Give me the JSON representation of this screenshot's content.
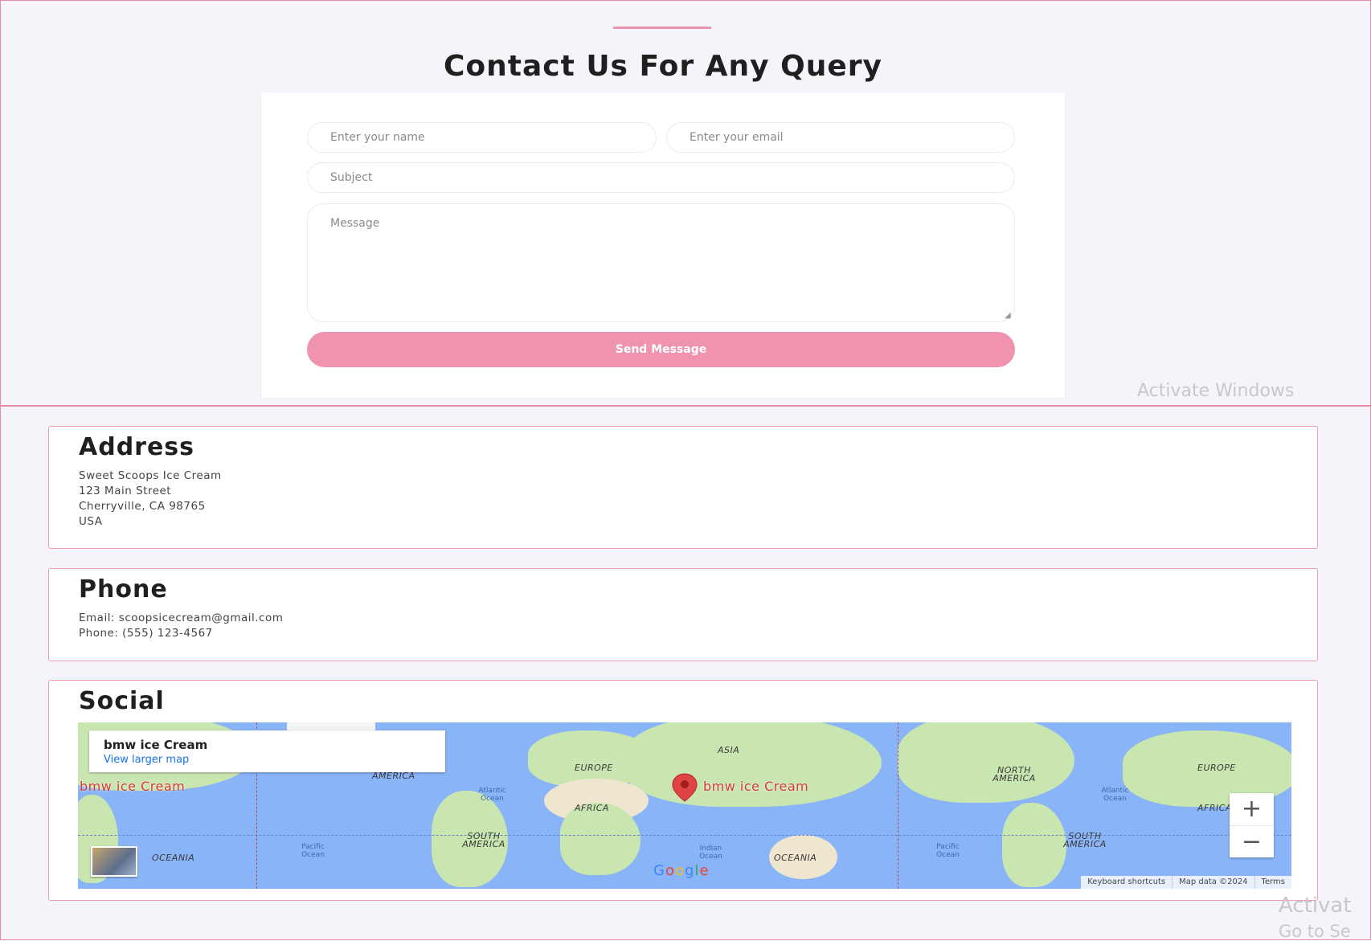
{
  "page": {
    "title": "Contact Us For Any Query"
  },
  "form": {
    "name_placeholder": "Enter your name",
    "email_placeholder": "Enter your email",
    "subject_placeholder": "Subject",
    "message_placeholder": "Message",
    "send_label": "Send Message"
  },
  "address": {
    "heading": "Address",
    "lines": [
      "Sweet Scoops Ice Cream",
      "123 Main Street",
      "Cherryville, CA 98765",
      "USA"
    ]
  },
  "phone": {
    "heading": "Phone",
    "email_line": "Email: scoopsicecream@gmail.com",
    "phone_line": "Phone: (555) 123-4567"
  },
  "social": {
    "heading": "Social",
    "map": {
      "place_name": "bmw ice Cream",
      "larger_map_link": "View larger map",
      "marker_label": "bmw ice Cream",
      "marker_label_left": "bmw ice Cream",
      "continents": [
        "AMERICA",
        "EUROPE",
        "ASIA",
        "AFRICA",
        "SOUTH AMERICA",
        "OCEANIA",
        "NORTH AMERICA",
        "EUROPE",
        "AFRICA",
        "SOUTH AMERICA",
        "OCEANIA"
      ],
      "oceans": [
        "Atlantic Ocean",
        "Pacific Ocean",
        "Indian Ocean",
        "Pacific Ocean",
        "Atlantic Ocean"
      ],
      "google_logo": "Google",
      "zoom_in": "+",
      "zoom_out": "−",
      "attribution": [
        "Keyboard shortcuts",
        "Map data ©2024",
        "Terms"
      ]
    }
  },
  "watermark": {
    "line1": "Activate Windows",
    "line2": "Activat",
    "line3": "Go to Se"
  },
  "colors": {
    "accent": "#ef93af",
    "border": "#ee9cb4",
    "link": "#1a73e8",
    "marker": "#d23a3a"
  }
}
